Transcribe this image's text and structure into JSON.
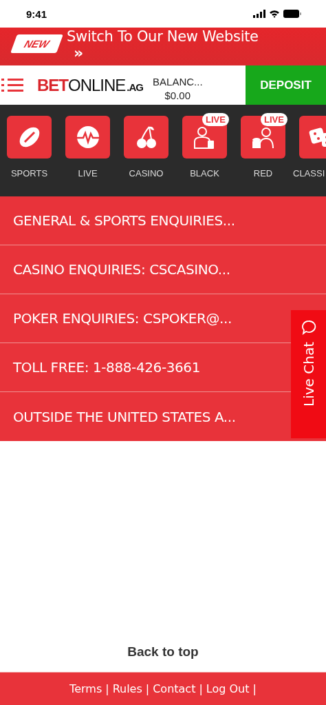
{
  "status_bar": {
    "time": "9:41"
  },
  "banner": {
    "badge": "NEW",
    "text": "Switch To Our New Website",
    "arrow": "»"
  },
  "header": {
    "logo": {
      "bet": "BET",
      "online": "ONLINE",
      "tld": ".AG"
    },
    "balance_label": "BALANC...",
    "balance": "$0.00",
    "deposit": "DEPOSIT"
  },
  "nav": [
    {
      "label": "SPORTS",
      "kind": "football",
      "live": false
    },
    {
      "label": "LIVE",
      "kind": "pulse",
      "live": false
    },
    {
      "label": "CASINO",
      "kind": "cherry",
      "live": false
    },
    {
      "label": "BLACK",
      "kind": "dealer",
      "live": true,
      "badge": "LIVE"
    },
    {
      "label": "RED",
      "kind": "chips",
      "live": true,
      "badge": "LIVE"
    },
    {
      "label": "CLASSI",
      "kind": "dice",
      "live": false
    }
  ],
  "contacts": [
    "GENERAL & SPORTS ENQUIRIES...",
    "CASINO ENQUIRIES: CSCASINO...",
    "POKER ENQUIRIES: CSPOKER@...",
    "TOLL FREE: 1-888-426-3661",
    "OUTSIDE THE UNITED STATES A..."
  ],
  "live_chat": "Live Chat",
  "back_to_top": "Back to top",
  "footer": {
    "links": [
      "Terms",
      "Rules",
      "Contact",
      "Log Out"
    ],
    "separator": "|"
  }
}
